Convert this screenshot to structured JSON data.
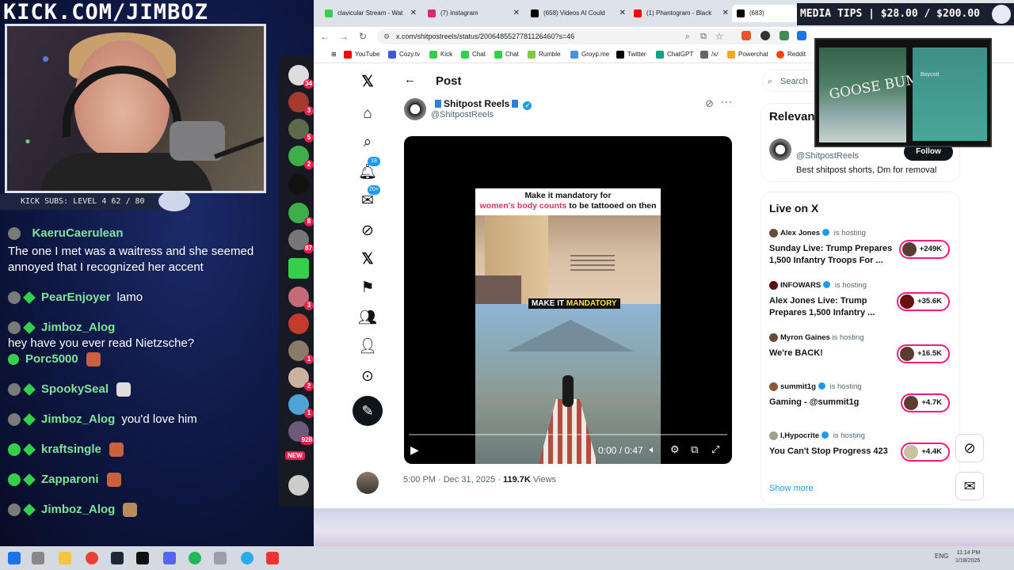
{
  "overlay": {
    "brand": "KICK.COM/JIMBOZ",
    "subs_bar": "KICK SUBS: LEVEL 4 62 / 80",
    "chat": [
      {
        "user": "KaeruCaerulean",
        "message": "The one I met was a waitress and she seemed annoyed that I recognized her accent"
      },
      {
        "user": "PearEnjoyer",
        "message": "lamo"
      },
      {
        "user": "Jimboz_Alog",
        "message": "hey have you ever read Nietzsche?"
      },
      {
        "user": "Porc5000",
        "message": ""
      },
      {
        "user": "SpookySeal",
        "message": ""
      },
      {
        "user": "Jimboz_Alog",
        "message": "you'd love him"
      },
      {
        "user": "kraftsingle",
        "message": ""
      },
      {
        "user": "Zapparoni",
        "message": ""
      },
      {
        "user": "Jimboz_Alog",
        "message": ""
      }
    ],
    "rail_counts": [
      "34",
      "3",
      "5",
      "2",
      "",
      "8",
      "87",
      "",
      "3",
      "",
      "1",
      "2",
      "1",
      "3",
      "928"
    ],
    "rail_new": "NEW",
    "media_tips": "MEDIA TIPS | $28.00 / $200.00",
    "media_thumb_left": "GOOSE BUMPS",
    "media_thumb_right": "Boycott"
  },
  "browser": {
    "tabs": [
      {
        "title": "clavicular Stream - Wat",
        "color": "#35d04b"
      },
      {
        "title": "(7) Instagram",
        "color": "#d62976"
      },
      {
        "title": "(658) Videos AI Could",
        "color": "#000000"
      },
      {
        "title": "(1) Phantogram - Black",
        "color": "#ff0000"
      },
      {
        "title": "(683)",
        "color": "#000000"
      }
    ],
    "url": "x.com/shitpostreels/status/2006485527781126460?s=46",
    "bookmarks": [
      "YouTube",
      "Cozy.tv",
      "Kick",
      "Chat",
      "Chat",
      "Rumble",
      "Groyp.me",
      "Twitter",
      "ChatGPT",
      "/x/",
      "Powerchat",
      "Reddit"
    ]
  },
  "x": {
    "nav_badges": {
      "notifications": "18",
      "messages": "20+"
    },
    "post_header": "Post",
    "author_name": "Shitpost Reels",
    "author_handle": "@ShitpostReels",
    "meme_line1": "Make it mandatory for",
    "meme_line2_pink": "women's body counts",
    "meme_line2_rest": " to be tattooed on then",
    "mandatory_a": "MAKE IT ",
    "mandatory_b": "MANDATORY",
    "video_time": "0:00 / 0:47",
    "post_time": "5:00 PM · Dec 31, 2025 · ",
    "views_count": "119.7K",
    "views_label": " Views",
    "search_placeholder": "Search",
    "relevant_title": "Relevan",
    "relevant_handle": "@ShitpostReels",
    "relevant_bio": "Best shitpost shorts, Dm for removal",
    "follow": "Follow",
    "live_title": "Live on X",
    "live": [
      {
        "host": "Alex Jones",
        "status": " is hosting",
        "title": "Sunday Live: Trump Prepares 1,500 Infantry Troops For ...",
        "count": "+249K"
      },
      {
        "host": "INFOWARS",
        "status": " is hosting",
        "title": "Alex Jones Live: Trump Prepares 1,500 Infantry ...",
        "count": "+35.6K"
      },
      {
        "host": "Myron Gaines",
        "status": " is hosting",
        "title": "We're BACK!",
        "count": "+16.5K"
      },
      {
        "host": "summit1g",
        "status": " is hosting",
        "title": "Gaming - @summit1g",
        "count": "+4.7K"
      },
      {
        "host": "I,Hypocrite",
        "status": " is hosting",
        "title": "You Can't Stop Progress 423",
        "count": "+4.4K"
      }
    ],
    "show_more": "Show more"
  },
  "taskbar": {
    "tray": "ENG",
    "clock_time": "11:14 PM",
    "clock_date": "1/18/2026"
  }
}
